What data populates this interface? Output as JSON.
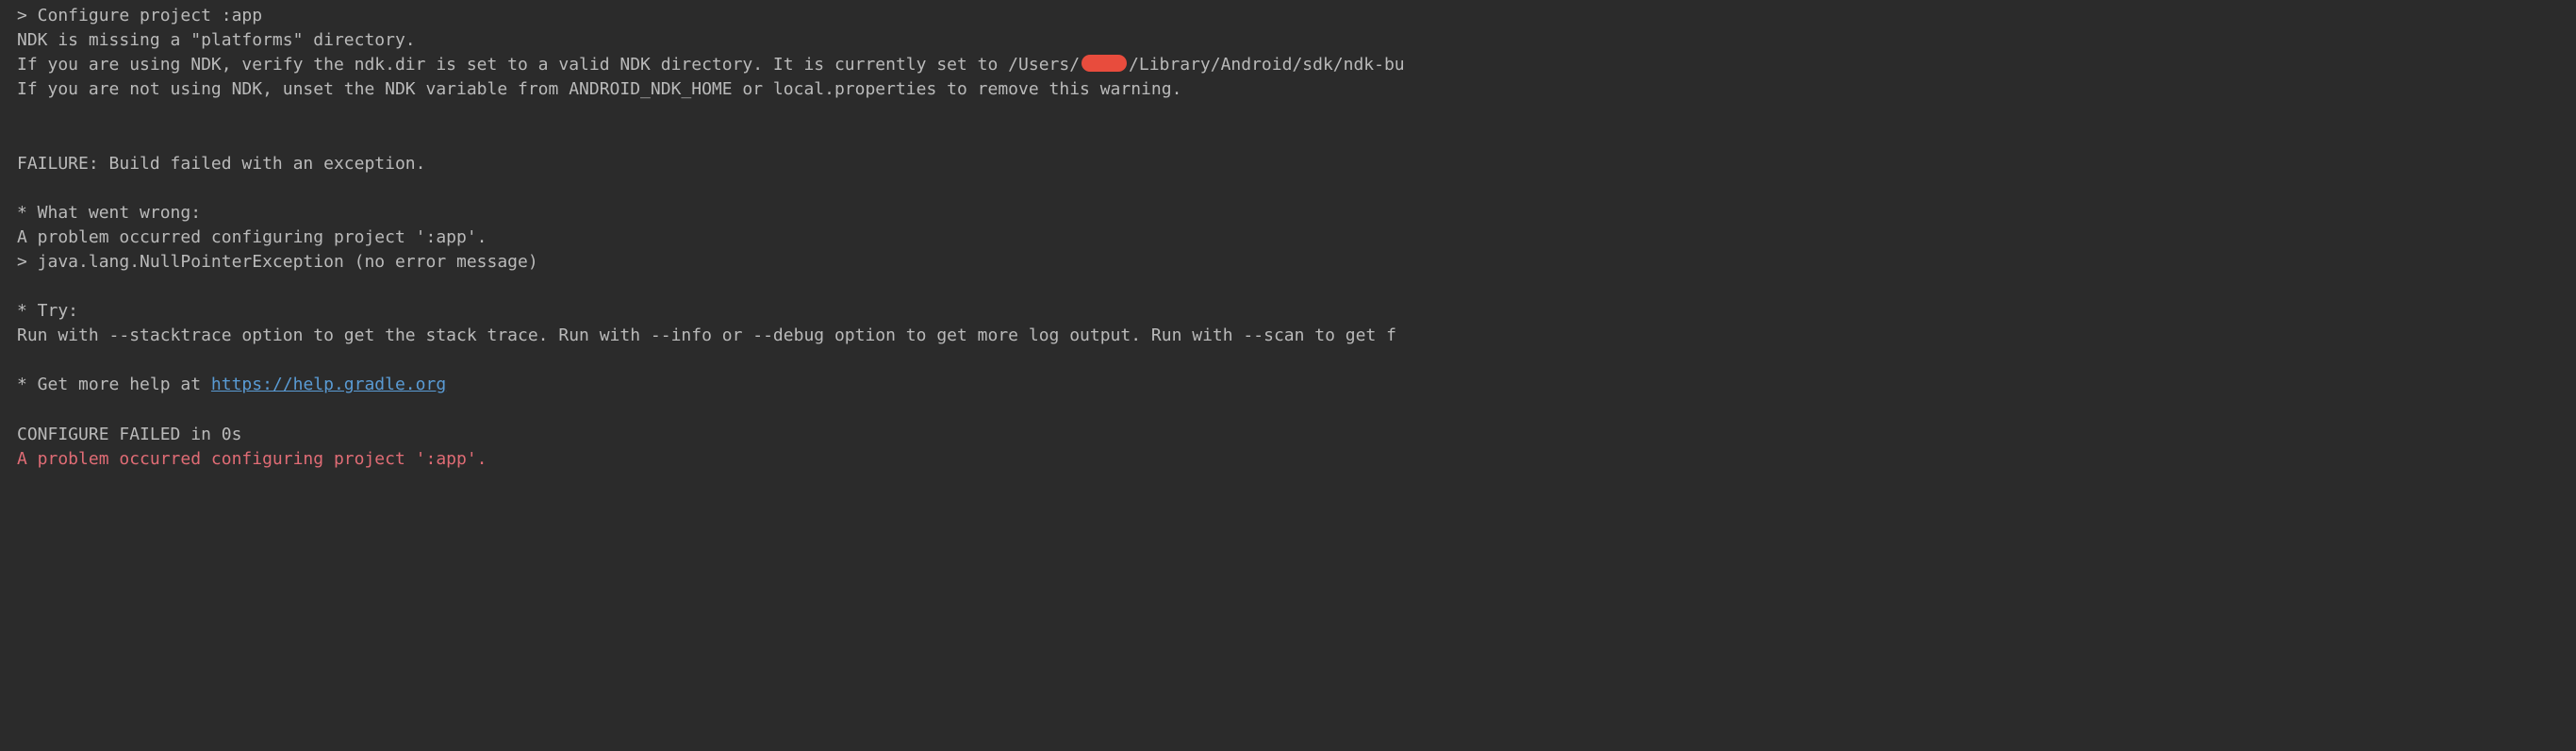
{
  "console": {
    "lines": {
      "configure": "> Configure project :app",
      "ndk_missing": "NDK is missing a \"platforms\" directory.",
      "ndk_verify_pre": "If you are using NDK, verify the ndk.dir is set to a valid NDK directory.  It is currently set to /Users/",
      "ndk_verify_post": "/Library/Android/sdk/ndk-bu",
      "ndk_unset": "If you are not using NDK, unset the NDK variable from ANDROID_NDK_HOME or local.properties to remove this warning.",
      "failure_header": "FAILURE: Build failed with an exception.",
      "what_wrong": "* What went wrong:",
      "problem_occurred": "A problem occurred configuring project ':app'.",
      "npe": "> java.lang.NullPointerException (no error message)",
      "try_header": "* Try:",
      "try_body": "Run with --stacktrace option to get the stack trace. Run with --info or --debug option to get more log output. Run with --scan to get f",
      "help_prefix": "* Get more help at ",
      "help_link": "https://help.gradle.org",
      "configure_failed": "CONFIGURE FAILED in 0s",
      "error_summary": "A problem occurred configuring project ':app'."
    }
  }
}
